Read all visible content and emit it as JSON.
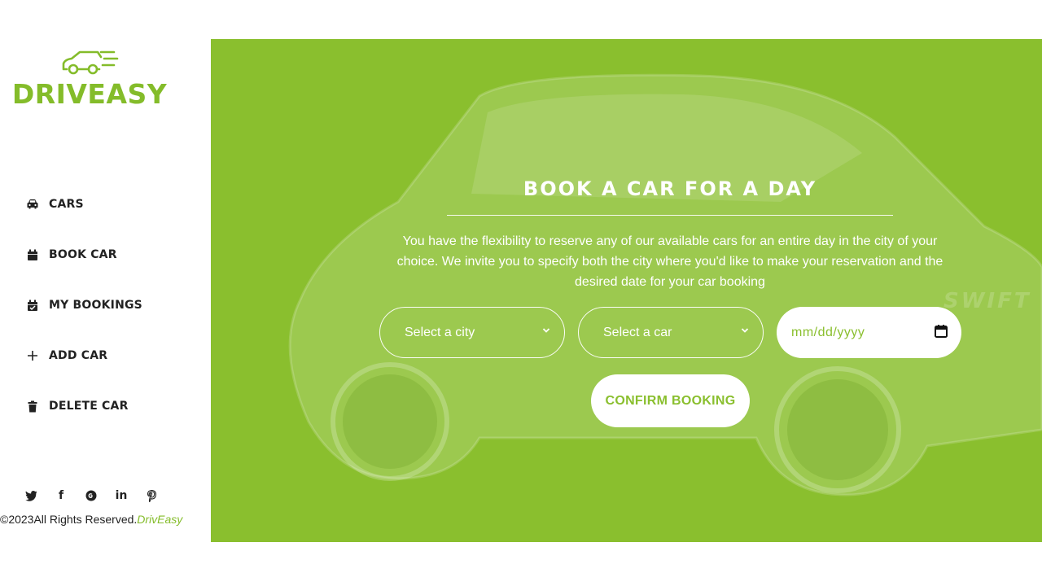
{
  "brand": {
    "name": "DRIVEASY",
    "color": "#84bc2a",
    "icon": "car-logo-icon"
  },
  "sidebar": {
    "items": [
      {
        "label": "CARS",
        "icon": "car-icon"
      },
      {
        "label": "BOOK CAR",
        "icon": "calendar-icon"
      },
      {
        "label": "MY BOOKINGS",
        "icon": "calendar-check-icon"
      },
      {
        "label": "ADD CAR",
        "icon": "plus-icon"
      },
      {
        "label": "DELETE CAR",
        "icon": "trash-icon"
      }
    ]
  },
  "social": {
    "twitter": "twitter-icon",
    "facebook": "f",
    "google": "google-plus-icon",
    "linkedin": "in",
    "pinterest": "pinterest-icon"
  },
  "footer": {
    "copyright": "©2023All Rights Reserved.",
    "brand": "DrivEasy"
  },
  "hero": {
    "background_color": "#8abf2e",
    "title": "BOOK A CAR FOR A DAY",
    "description": "You have the flexibility to reserve any of our available cars for an entire day in the city of your choice. We invite you to specify both the city where you'd like to make your reservation and the desired date for your car booking",
    "form": {
      "city_select": "Select a city",
      "car_select": "Select a car",
      "date_placeholder": "mm/dd/yyyy",
      "confirm_label": "CONFIRM BOOKING"
    }
  }
}
